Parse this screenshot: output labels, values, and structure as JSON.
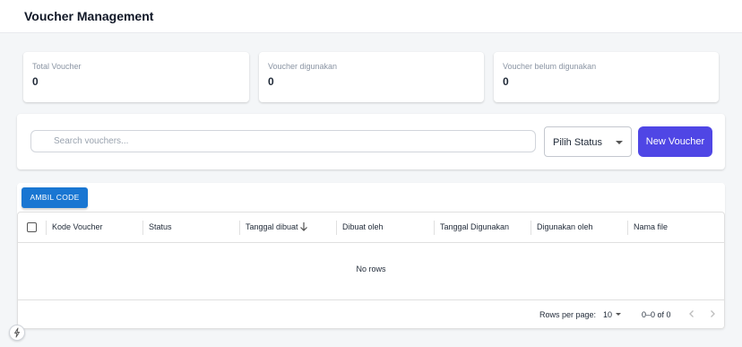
{
  "header": {
    "title": "Voucher Management"
  },
  "stats": [
    {
      "label": "Total Voucher",
      "value": "0"
    },
    {
      "label": "Voucher digunakan",
      "value": "0"
    },
    {
      "label": "Voucher belum digunakan",
      "value": "0"
    }
  ],
  "filters": {
    "search_placeholder": "Search vouchers...",
    "status_value": "Pilih Status",
    "new_button": "New Voucher"
  },
  "grid": {
    "ambil_button": "AMBIL CODE",
    "columns": [
      "Kode Voucher",
      "Status",
      "Tanggal dibuat",
      "Dibuat oleh",
      "Tanggal Digunakan",
      "Digunakan oleh",
      "Nama file"
    ],
    "sorted_column": "Tanggal dibuat",
    "sort_direction": "descending",
    "empty_text": "No rows",
    "footer": {
      "rows_per_page_label": "Rows per page:",
      "rows_per_page_value": "10",
      "range": "0–0 of 0"
    }
  },
  "colors": {
    "primary": "#4f46e5",
    "ambil_button": "#1976d2",
    "background": "#f4f6f8"
  }
}
